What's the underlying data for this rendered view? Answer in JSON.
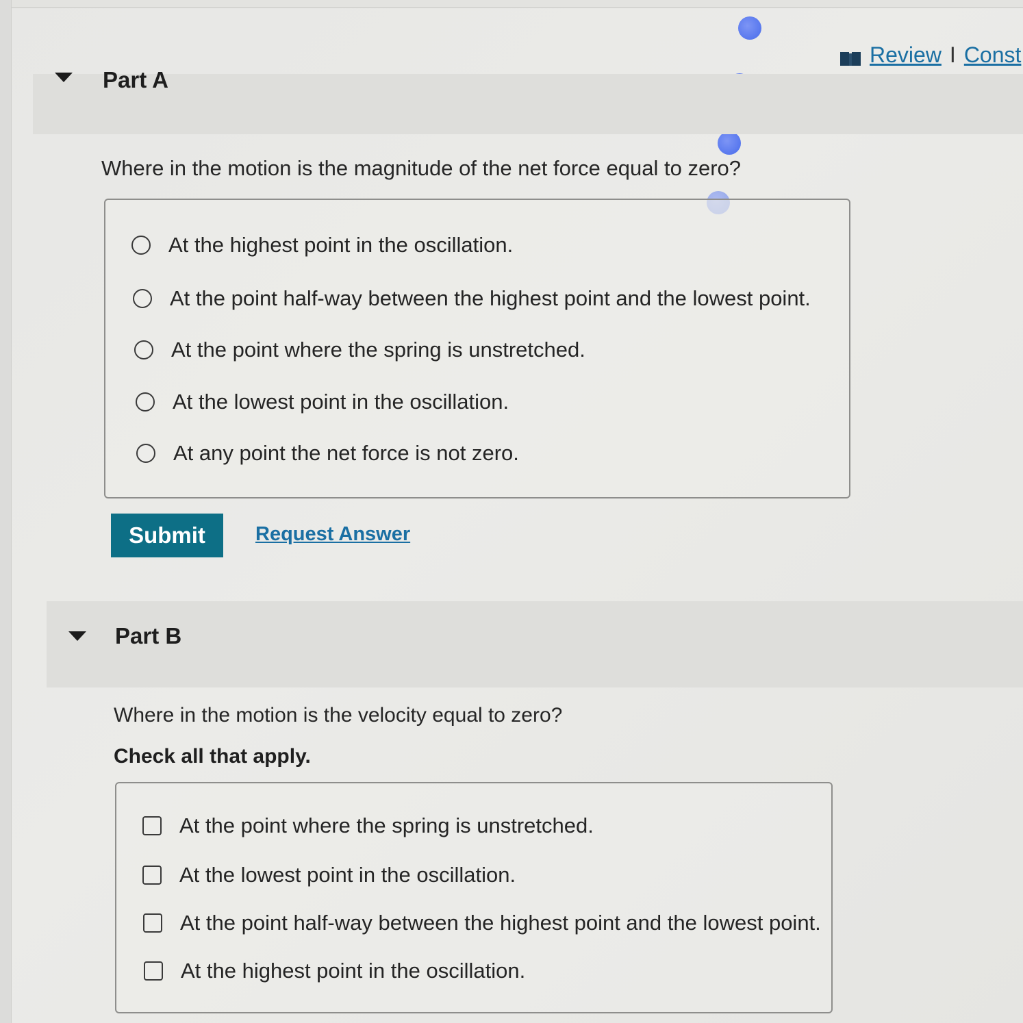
{
  "top_links": {
    "review": "Review",
    "separator": "I",
    "constants": "Const"
  },
  "part_a": {
    "title": "Part A",
    "question": "Where in the motion is the magnitude of the net force equal to zero?",
    "options": [
      {
        "label": "At the highest point in the oscillation.",
        "selected": false
      },
      {
        "label": "At the point half-way between the highest point and the lowest point.",
        "selected": false
      },
      {
        "label": "At the point where the spring is unstretched.",
        "selected": false
      },
      {
        "label": "At the lowest point in the oscillation.",
        "selected": false
      },
      {
        "label": "At any point the net force is not zero.",
        "selected": false
      }
    ],
    "submit_label": "Submit",
    "request_answer_label": "Request Answer"
  },
  "part_b": {
    "title": "Part B",
    "question": "Where in the motion is the velocity equal to zero?",
    "instruction": "Check all that apply.",
    "options": [
      {
        "label": "At the point where the spring is unstretched.",
        "checked": false
      },
      {
        "label": "At the lowest point in the oscillation.",
        "checked": false
      },
      {
        "label": "At the point half-way between the highest point and the lowest point.",
        "checked": false
      },
      {
        "label": "At the highest point in the oscillation.",
        "checked": false
      }
    ]
  },
  "colors": {
    "accent": "#0d6f86",
    "link": "#1a6fa3",
    "progress_dot": "#5878ee"
  }
}
